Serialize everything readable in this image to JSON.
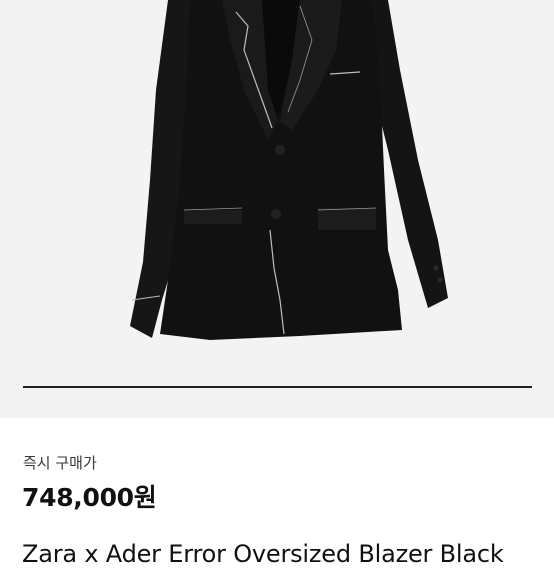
{
  "gallery": {
    "image_alt": "black blazer product photo",
    "progress": 1.0,
    "colors": {
      "background": "#f3f3f3",
      "jacket": "#141414",
      "stitch": "#bdbdbd"
    }
  },
  "purchase": {
    "label": "즉시 구매가",
    "price": "748,000원"
  },
  "product": {
    "title": "Zara x Ader Error Oversized Blazer Black"
  }
}
